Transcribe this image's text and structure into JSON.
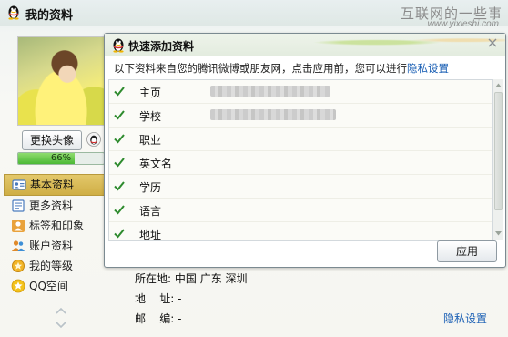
{
  "window": {
    "title": "我的资料",
    "watermark_text": "互联网的一些事",
    "watermark_url": "www.yixieshi.com"
  },
  "profile": {
    "change_avatar_label": "更换头像",
    "completion_text": "66%",
    "completion_fraction": 0.66
  },
  "nav": {
    "items": [
      {
        "label": "基本资料",
        "icon": "id-card-icon",
        "active": true
      },
      {
        "label": "更多资料",
        "icon": "document-icon",
        "active": false
      },
      {
        "label": "标签和印象",
        "icon": "person-tag-icon",
        "active": false
      },
      {
        "label": "账户资料",
        "icon": "users-icon",
        "active": false
      },
      {
        "label": "我的等级",
        "icon": "medal-icon",
        "active": false
      },
      {
        "label": "QQ空间",
        "icon": "qzone-star-icon",
        "active": false
      }
    ]
  },
  "details": {
    "location_label": "所在地:",
    "location_value": "中国  广东  深圳",
    "address_label": "地    址:",
    "address_value": "-",
    "postcode_label": "邮    编:",
    "postcode_value": "-",
    "privacy_link": "隐私设置"
  },
  "dialog": {
    "title": "快速添加资料",
    "description": "以下资料来自您的腾讯微博或朋友网，点击应用前，您可以进行",
    "privacy_link": "隐私设置",
    "items": [
      {
        "label": "主页",
        "checked": true,
        "value_blurred": true
      },
      {
        "label": "学校",
        "checked": true,
        "value_blurred": true
      },
      {
        "label": "职业",
        "checked": true,
        "value_blurred": false
      },
      {
        "label": "英文名",
        "checked": true,
        "value_blurred": false
      },
      {
        "label": "学历",
        "checked": true,
        "value_blurred": false
      },
      {
        "label": "语言",
        "checked": true,
        "value_blurred": false
      },
      {
        "label": "地址",
        "checked": true,
        "value_blurred": false
      }
    ],
    "apply_label": "应用"
  },
  "colors": {
    "link": "#1a5fb4",
    "check": "#2e8b2e",
    "progress": "#4bb935",
    "active_nav": "#cfae45"
  }
}
